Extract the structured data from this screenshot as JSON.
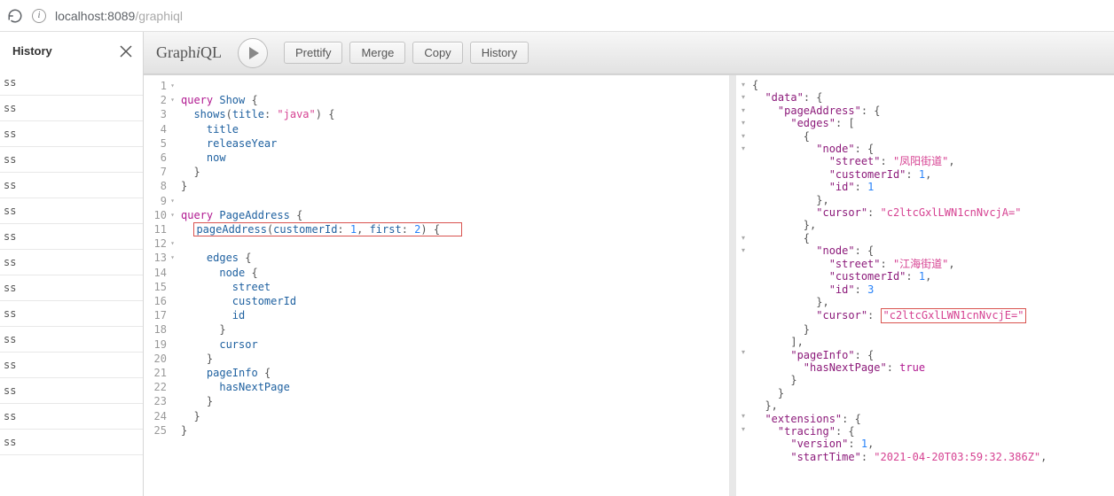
{
  "browser": {
    "host": "localhost:",
    "port": "8089",
    "path": "/graphiql"
  },
  "history": {
    "title": "History",
    "items": [
      "ss",
      "ss",
      "ss",
      "ss",
      "ss",
      "ss",
      "ss",
      "ss",
      "ss",
      "ss",
      "ss",
      "ss",
      "ss",
      "ss",
      "ss"
    ]
  },
  "logo": {
    "pre": "Graph",
    "i": "i",
    "post": "QL"
  },
  "toolbar": {
    "prettify": "Prettify",
    "merge": "Merge",
    "copy": "Copy",
    "history": "History"
  },
  "lineNumbers": [
    "1",
    "2",
    "3",
    "4",
    "5",
    "6",
    "7",
    "8",
    "9",
    "10",
    "11",
    "12",
    "13",
    "14",
    "15",
    "16",
    "17",
    "18",
    "19",
    "20",
    "21",
    "22",
    "23",
    "24",
    "25"
  ],
  "foldLines": [
    1,
    2,
    9,
    10,
    12,
    13
  ],
  "query": {
    "l1_kw": "query",
    "l1_name": "Show",
    "l1_ob": "{",
    "l2_field": "shows",
    "l2_op": "(",
    "l2_arg": "title",
    "l2_colon": ": ",
    "l2_val": "\"java\"",
    "l2_close": ") {",
    "l3": "title",
    "l4": "releaseYear",
    "l5": "now",
    "l6": "}",
    "l7": "}",
    "l8": "",
    "l9_kw": "query",
    "l9_name": "PageAddress",
    "l9_ob": "{",
    "l10_field": "pageAddress",
    "l10_open": "(",
    "l10_arg1": "customerId",
    "l10_v1": "1",
    "l10_arg2": "first",
    "l10_v2": "2",
    "l10_close": ") {",
    "l11": "",
    "l12": "edges {",
    "l13": "node {",
    "l14": "street",
    "l15": "customerId",
    "l16": "id",
    "l17": "}",
    "l18": "cursor",
    "l19": "}",
    "l20": "pageInfo {",
    "l21": "hasNextPage",
    "l22": "}",
    "l23": "}",
    "l24": "}",
    "l25": ""
  },
  "result": {
    "r1": "{",
    "data_k": "\"data\"",
    "colon": ": ",
    "ob": "{",
    "cb": "}",
    "osb": "[",
    "csb": "]",
    "comma": ",",
    "pageAddress_k": "\"pageAddress\"",
    "edges_k": "\"edges\"",
    "node_k": "\"node\"",
    "street_k": "\"street\"",
    "street1_v": "\"凤阳街道\"",
    "street2_v": "\"江海街道\"",
    "customerId_k": "\"customerId\"",
    "customerId_v": "1",
    "id_k": "\"id\"",
    "id1_v": "1",
    "id2_v": "3",
    "cursor_k": "\"cursor\"",
    "cursor1_v": "\"c2ltcGxlLWN1cnNvcjA=\"",
    "cursor2_v": "\"c2ltcGxlLWN1cnNvcjE=\"",
    "pageInfo_k": "\"pageInfo\"",
    "hasNextPage_k": "\"hasNextPage\"",
    "hasNextPage_v": "true",
    "extensions_k": "\"extensions\"",
    "tracing_k": "\"tracing\"",
    "version_k": "\"version\"",
    "version_v": "1",
    "startTime_k": "\"startTime\"",
    "startTime_v": "\"2021-04-20T03:59:32.386Z\""
  }
}
